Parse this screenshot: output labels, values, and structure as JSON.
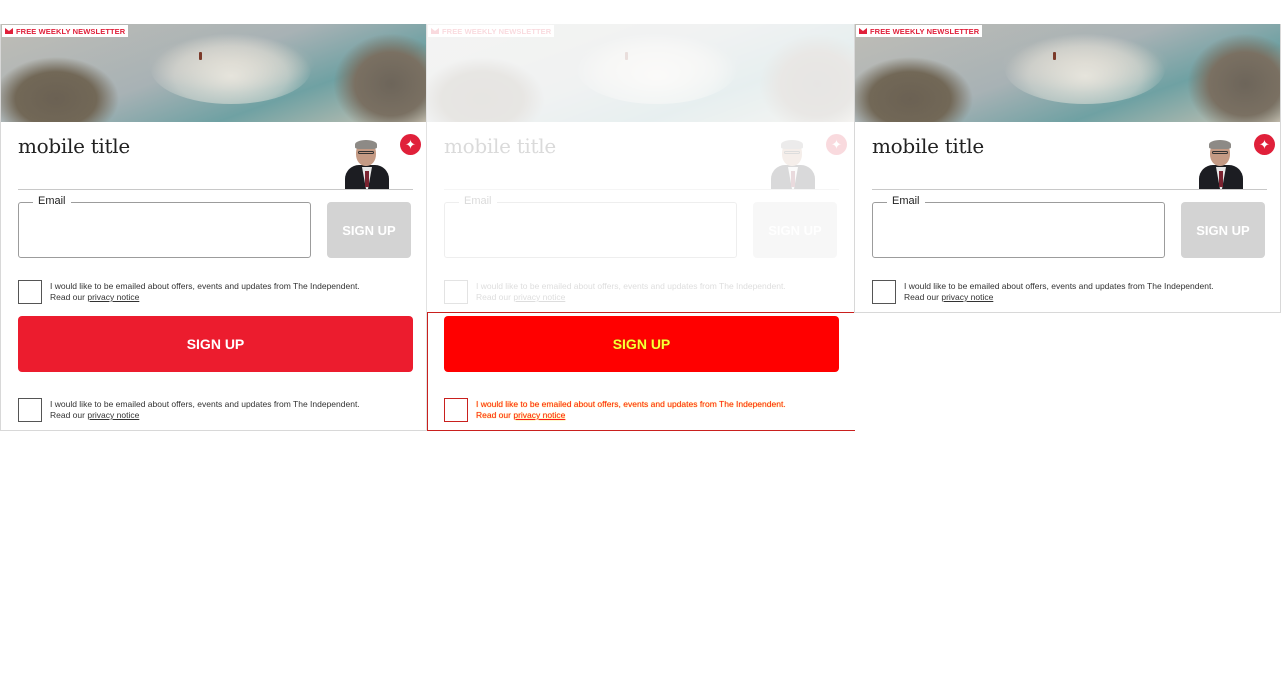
{
  "newsletter": {
    "badge": "FREE WEEKLY NEWSLETTER",
    "title": "mobile title",
    "email_label": "Email",
    "email_value": "",
    "signup_small": "SIGN UP",
    "signup_big": "SIGN UP",
    "consent_text": "I would like to be emailed about offers, events and updates from The Independent.",
    "read_our": "Read our ",
    "privacy_link": "privacy notice",
    "logo_icon": "independent-eagle-icon"
  },
  "colors": {
    "brand_red": "#ec1c2e",
    "disabled_gray": "#d3d3d3",
    "highlight_red": "#ff0000",
    "highlight_text": "#ffff33"
  }
}
